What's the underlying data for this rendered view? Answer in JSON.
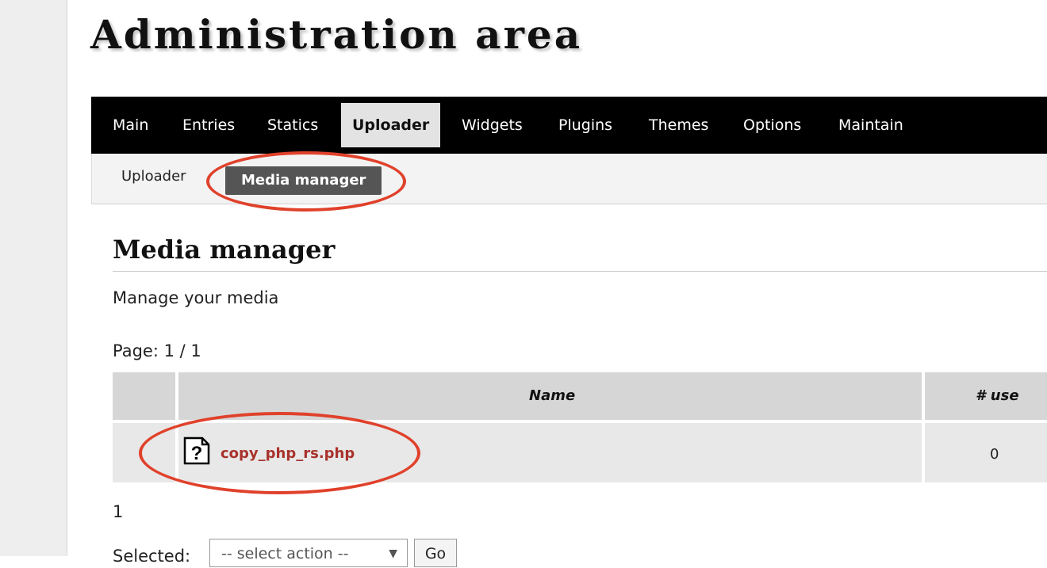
{
  "page": {
    "title": "Administration area"
  },
  "nav": {
    "tabs": [
      {
        "label": "Main"
      },
      {
        "label": "Entries"
      },
      {
        "label": "Statics"
      },
      {
        "label": "Uploader"
      },
      {
        "label": "Widgets"
      },
      {
        "label": "Plugins"
      },
      {
        "label": "Themes"
      },
      {
        "label": "Options"
      },
      {
        "label": "Maintain"
      }
    ],
    "active_tab": "Uploader"
  },
  "subnav": {
    "items": [
      {
        "label": "Uploader"
      },
      {
        "label": "Media manager"
      }
    ],
    "active_item": "Media manager"
  },
  "section": {
    "title": "Media manager",
    "description": "Manage your media",
    "page_info": "Page: 1 / 1"
  },
  "table": {
    "headers": [
      "",
      "Name",
      "# use"
    ],
    "rows": [
      {
        "icon": "unknown-file-icon",
        "name": "copy_php_rs.php",
        "uses": "0"
      }
    ]
  },
  "pagination": {
    "current": "1"
  },
  "bulk": {
    "label": "Selected:",
    "select_value": "-- select action --",
    "go_label": "Go"
  },
  "annotation": {
    "color": "#e0412b"
  },
  "colors": {
    "nav_bg": "#000000",
    "link": "#a8322b",
    "active_subtab": "#555555"
  }
}
